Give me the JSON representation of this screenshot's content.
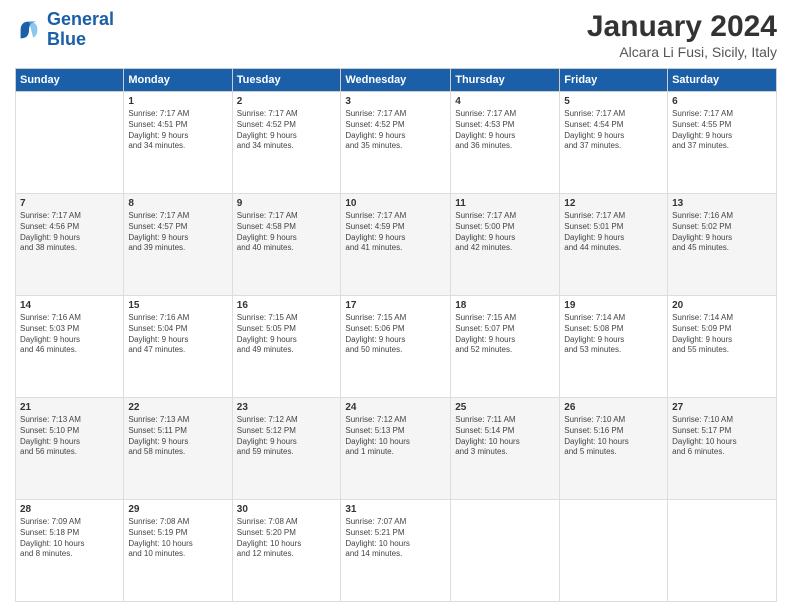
{
  "header": {
    "logo_line1": "General",
    "logo_line2": "Blue",
    "title": "January 2024",
    "subtitle": "Alcara Li Fusi, Sicily, Italy"
  },
  "days_of_week": [
    "Sunday",
    "Monday",
    "Tuesday",
    "Wednesday",
    "Thursday",
    "Friday",
    "Saturday"
  ],
  "weeks": [
    [
      {
        "day": "",
        "info": ""
      },
      {
        "day": "1",
        "info": "Sunrise: 7:17 AM\nSunset: 4:51 PM\nDaylight: 9 hours\nand 34 minutes."
      },
      {
        "day": "2",
        "info": "Sunrise: 7:17 AM\nSunset: 4:52 PM\nDaylight: 9 hours\nand 34 minutes."
      },
      {
        "day": "3",
        "info": "Sunrise: 7:17 AM\nSunset: 4:52 PM\nDaylight: 9 hours\nand 35 minutes."
      },
      {
        "day": "4",
        "info": "Sunrise: 7:17 AM\nSunset: 4:53 PM\nDaylight: 9 hours\nand 36 minutes."
      },
      {
        "day": "5",
        "info": "Sunrise: 7:17 AM\nSunset: 4:54 PM\nDaylight: 9 hours\nand 37 minutes."
      },
      {
        "day": "6",
        "info": "Sunrise: 7:17 AM\nSunset: 4:55 PM\nDaylight: 9 hours\nand 37 minutes."
      }
    ],
    [
      {
        "day": "7",
        "info": "Sunrise: 7:17 AM\nSunset: 4:56 PM\nDaylight: 9 hours\nand 38 minutes."
      },
      {
        "day": "8",
        "info": "Sunrise: 7:17 AM\nSunset: 4:57 PM\nDaylight: 9 hours\nand 39 minutes."
      },
      {
        "day": "9",
        "info": "Sunrise: 7:17 AM\nSunset: 4:58 PM\nDaylight: 9 hours\nand 40 minutes."
      },
      {
        "day": "10",
        "info": "Sunrise: 7:17 AM\nSunset: 4:59 PM\nDaylight: 9 hours\nand 41 minutes."
      },
      {
        "day": "11",
        "info": "Sunrise: 7:17 AM\nSunset: 5:00 PM\nDaylight: 9 hours\nand 42 minutes."
      },
      {
        "day": "12",
        "info": "Sunrise: 7:17 AM\nSunset: 5:01 PM\nDaylight: 9 hours\nand 44 minutes."
      },
      {
        "day": "13",
        "info": "Sunrise: 7:16 AM\nSunset: 5:02 PM\nDaylight: 9 hours\nand 45 minutes."
      }
    ],
    [
      {
        "day": "14",
        "info": "Sunrise: 7:16 AM\nSunset: 5:03 PM\nDaylight: 9 hours\nand 46 minutes."
      },
      {
        "day": "15",
        "info": "Sunrise: 7:16 AM\nSunset: 5:04 PM\nDaylight: 9 hours\nand 47 minutes."
      },
      {
        "day": "16",
        "info": "Sunrise: 7:15 AM\nSunset: 5:05 PM\nDaylight: 9 hours\nand 49 minutes."
      },
      {
        "day": "17",
        "info": "Sunrise: 7:15 AM\nSunset: 5:06 PM\nDaylight: 9 hours\nand 50 minutes."
      },
      {
        "day": "18",
        "info": "Sunrise: 7:15 AM\nSunset: 5:07 PM\nDaylight: 9 hours\nand 52 minutes."
      },
      {
        "day": "19",
        "info": "Sunrise: 7:14 AM\nSunset: 5:08 PM\nDaylight: 9 hours\nand 53 minutes."
      },
      {
        "day": "20",
        "info": "Sunrise: 7:14 AM\nSunset: 5:09 PM\nDaylight: 9 hours\nand 55 minutes."
      }
    ],
    [
      {
        "day": "21",
        "info": "Sunrise: 7:13 AM\nSunset: 5:10 PM\nDaylight: 9 hours\nand 56 minutes."
      },
      {
        "day": "22",
        "info": "Sunrise: 7:13 AM\nSunset: 5:11 PM\nDaylight: 9 hours\nand 58 minutes."
      },
      {
        "day": "23",
        "info": "Sunrise: 7:12 AM\nSunset: 5:12 PM\nDaylight: 9 hours\nand 59 minutes."
      },
      {
        "day": "24",
        "info": "Sunrise: 7:12 AM\nSunset: 5:13 PM\nDaylight: 10 hours\nand 1 minute."
      },
      {
        "day": "25",
        "info": "Sunrise: 7:11 AM\nSunset: 5:14 PM\nDaylight: 10 hours\nand 3 minutes."
      },
      {
        "day": "26",
        "info": "Sunrise: 7:10 AM\nSunset: 5:16 PM\nDaylight: 10 hours\nand 5 minutes."
      },
      {
        "day": "27",
        "info": "Sunrise: 7:10 AM\nSunset: 5:17 PM\nDaylight: 10 hours\nand 6 minutes."
      }
    ],
    [
      {
        "day": "28",
        "info": "Sunrise: 7:09 AM\nSunset: 5:18 PM\nDaylight: 10 hours\nand 8 minutes."
      },
      {
        "day": "29",
        "info": "Sunrise: 7:08 AM\nSunset: 5:19 PM\nDaylight: 10 hours\nand 10 minutes."
      },
      {
        "day": "30",
        "info": "Sunrise: 7:08 AM\nSunset: 5:20 PM\nDaylight: 10 hours\nand 12 minutes."
      },
      {
        "day": "31",
        "info": "Sunrise: 7:07 AM\nSunset: 5:21 PM\nDaylight: 10 hours\nand 14 minutes."
      },
      {
        "day": "",
        "info": ""
      },
      {
        "day": "",
        "info": ""
      },
      {
        "day": "",
        "info": ""
      }
    ]
  ]
}
